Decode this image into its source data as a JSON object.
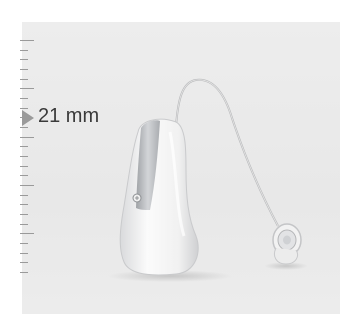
{
  "measurement": {
    "label": "21 mm"
  },
  "ruler": {
    "tick_count": 25,
    "major_every": 5
  },
  "device": {
    "name": "hearing-aid",
    "body_color": "#f4f4f4",
    "accent_color": "#b9bcc0"
  }
}
